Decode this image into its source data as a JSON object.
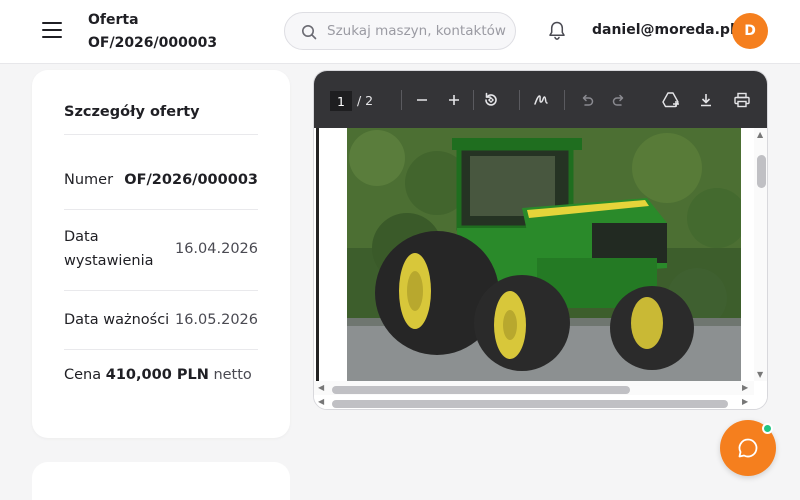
{
  "header": {
    "title_line1": "Oferta",
    "title_line2": "OF/2026/000003",
    "search_placeholder": "Szukaj maszyn, kontaktów",
    "user_email": "daniel@moreda.pl",
    "avatar_initial": "D"
  },
  "details": {
    "title": "Szczegóły oferty",
    "number_label": "Numer",
    "number_value": "OF/2026/000003",
    "issued_label_line1": "Data",
    "issued_label_line2": "wystawienia",
    "issued_value": "16.04.2026",
    "valid_label": "Data ważności",
    "valid_value": "16.05.2026",
    "price_label": "Cena",
    "price_value": "410,000 PLN",
    "price_suffix": "netto"
  },
  "pdf_viewer": {
    "current_page": "1",
    "total_pages": "/ 2",
    "toolbar_icons": [
      "zoom-out-icon",
      "zoom-in-icon",
      "rotate-icon",
      "draw-icon",
      "undo-icon",
      "redo-icon",
      "add-to-drive-icon",
      "download-icon",
      "print-icon"
    ]
  },
  "colors": {
    "accent": "#f57f1e",
    "toolbar_bg": "#343437",
    "online_dot": "#20c584"
  },
  "chat": {
    "icon": "chat-bubble-icon"
  }
}
